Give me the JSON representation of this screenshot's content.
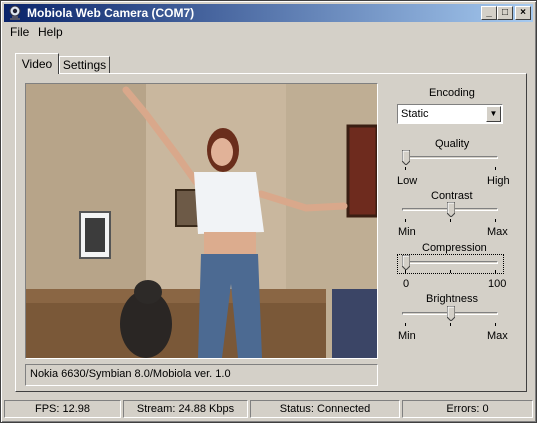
{
  "window": {
    "title": "Mobiola Web Camera (COM7)"
  },
  "titlebar_buttons": {
    "minimize": "_",
    "maximize": "□",
    "close": "×"
  },
  "menu": {
    "items": [
      "File",
      "Help"
    ]
  },
  "tabs": [
    {
      "label": "Video",
      "active": true
    },
    {
      "label": "Settings",
      "active": false
    }
  ],
  "video": {
    "caption": "Nokia 6630/Symbian 8.0/Mobiola ver. 1.0"
  },
  "controls": {
    "encoding": {
      "label": "Encoding",
      "value": "Static"
    },
    "quality": {
      "label": "Quality",
      "min_label": "Low",
      "max_label": "High",
      "level": 0.0
    },
    "contrast": {
      "label": "Contrast",
      "min_label": "Min",
      "max_label": "Max",
      "level": 0.5
    },
    "compression": {
      "label": "Compression",
      "min_label": "0",
      "max_label": "100",
      "level": 0.0
    },
    "brightness": {
      "label": "Brightness",
      "min_label": "Min",
      "max_label": "Max",
      "level": 0.5
    }
  },
  "status": {
    "fps": "FPS: 12.98",
    "stream": "Stream: 24.88 Kbps",
    "connection": "Status: Connected",
    "errors": "Errors: 0"
  },
  "colors": {
    "titlebar_start": "#0a246a",
    "titlebar_end": "#a6caf0",
    "face": "#d4d0c8"
  }
}
